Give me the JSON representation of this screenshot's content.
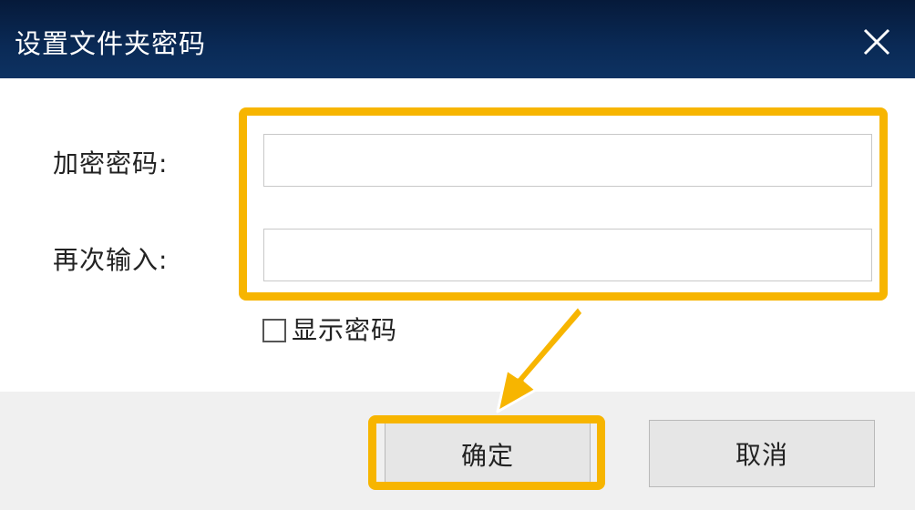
{
  "window": {
    "title": "设置文件夹密码",
    "close_icon": "close-icon"
  },
  "form": {
    "password_label": "加密密码:",
    "confirm_label": "再次输入:",
    "password_value": "",
    "confirm_value": "",
    "show_password_label": "显示密码",
    "show_password_checked": false
  },
  "buttons": {
    "ok_label": "确定",
    "cancel_label": "取消"
  },
  "colors": {
    "titlebar": "#0a2a56",
    "highlight": "#f7b500",
    "footer": "#f0f0f0"
  },
  "annotations": {
    "arrow_icon": "arrow-pointing-down-left-icon"
  }
}
